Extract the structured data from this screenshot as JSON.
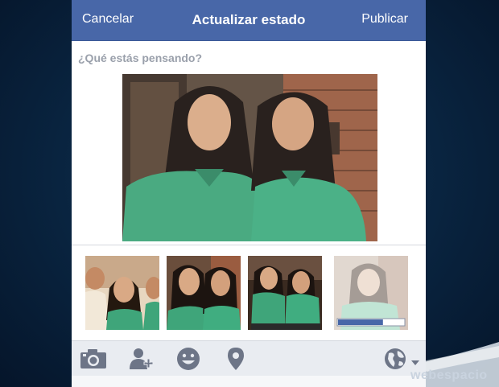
{
  "header": {
    "cancel_label": "Cancelar",
    "title": "Actualizar estado",
    "publish_label": "Publicar"
  },
  "composer": {
    "placeholder": "¿Qué estás pensando?"
  },
  "thumbnails": {
    "upload_progress": 0.68
  },
  "toolbar": {
    "icons": [
      "camera-icon",
      "tag-friend-icon",
      "smiley-icon",
      "location-pin-icon",
      "globe-icon",
      "dropdown-arrow-icon"
    ]
  },
  "watermark": {
    "text": "webespacio"
  },
  "colors": {
    "header_bg": "#4867a8",
    "toolbar_bg": "#e9ecf1",
    "icon_color": "#6d7587"
  }
}
